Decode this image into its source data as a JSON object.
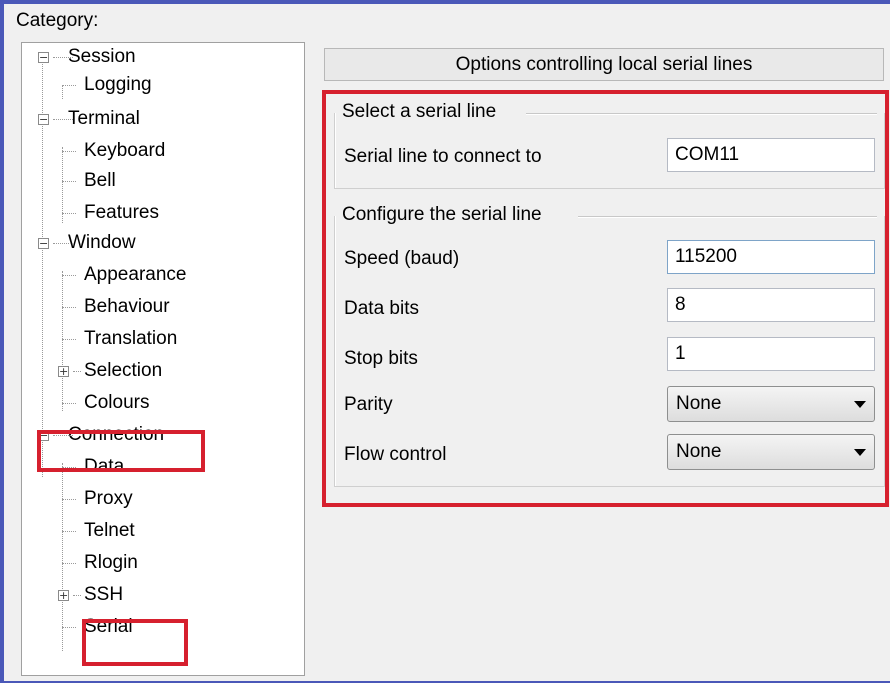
{
  "category_label": "Category:",
  "tree": [
    {
      "label": "Session",
      "expander": "⊟"
    },
    {
      "label": "Logging"
    },
    {
      "label": "Terminal",
      "expander": "⊟"
    },
    {
      "label": "Keyboard"
    },
    {
      "label": "Bell"
    },
    {
      "label": "Features"
    },
    {
      "label": "Window",
      "expander": "⊟"
    },
    {
      "label": "Appearance"
    },
    {
      "label": "Behaviour"
    },
    {
      "label": "Translation"
    },
    {
      "label": "Selection",
      "expander": "⊞"
    },
    {
      "label": "Colours"
    },
    {
      "label": "Connection",
      "expander": "⊟"
    },
    {
      "label": "Data"
    },
    {
      "label": "Proxy"
    },
    {
      "label": "Telnet"
    },
    {
      "label": "Rlogin"
    },
    {
      "label": "SSH",
      "expander": "⊞"
    },
    {
      "label": "Serial"
    }
  ],
  "panel": {
    "header": "Options controlling local serial lines",
    "group1_title": "Select a serial line",
    "serial_line_label": "Serial line to connect to",
    "serial_line_value": "COM11",
    "group2_title": "Configure the serial line",
    "speed_label": "Speed (baud)",
    "speed_value": "115200",
    "data_bits_label": "Data bits",
    "data_bits_value": "8",
    "stop_bits_label": "Stop bits",
    "stop_bits_value": "1",
    "parity_label": "Parity",
    "parity_value": "None",
    "flow_control_label": "Flow control",
    "flow_control_value": "None"
  },
  "colors": {
    "highlight_red": "#d6202e",
    "window_border": "#4a58b8"
  }
}
